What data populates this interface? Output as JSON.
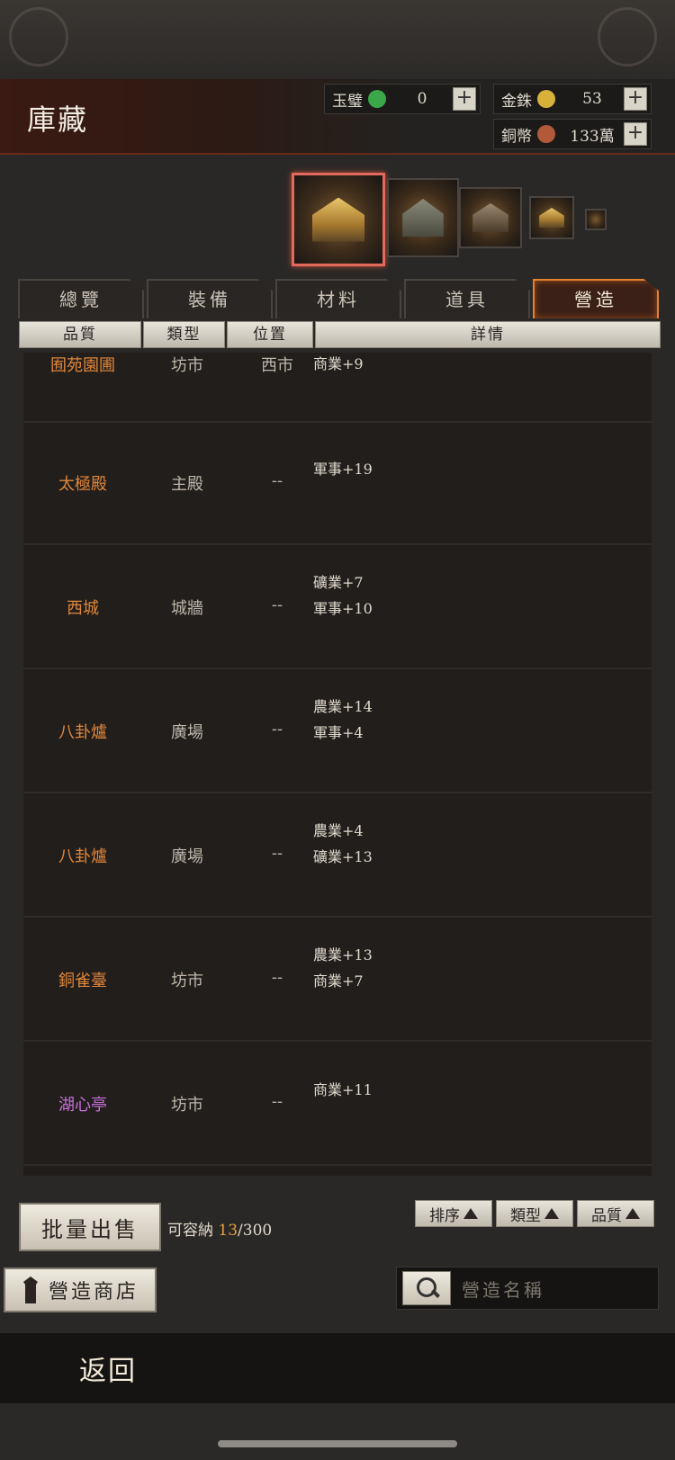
{
  "header": {
    "title": "庫藏",
    "currencies": [
      {
        "label": "玉璧",
        "value": "0",
        "coin_color": "#3aa84a"
      },
      {
        "label": "金銖",
        "value": "53",
        "coin_color": "#d8b13a"
      },
      {
        "label": "銅幣",
        "value": "133萬",
        "coin_color": "#b05a3a"
      }
    ]
  },
  "tabs": [
    "總覽",
    "裝備",
    "材料",
    "道具",
    "營造"
  ],
  "active_tab": "營造",
  "columns": {
    "quality": "品質",
    "type": "類型",
    "location": "位置",
    "detail": "詳情"
  },
  "rows": [
    {
      "name": "囿苑園圃",
      "type": "坊市",
      "location": "西市",
      "details": [
        "商業+9"
      ],
      "quality_color": "#e0873a"
    },
    {
      "name": "太極殿",
      "type": "主殿",
      "location": "--",
      "details": [
        "軍事+19"
      ],
      "quality_color": "#e0873a"
    },
    {
      "name": "西城",
      "type": "城牆",
      "location": "--",
      "details": [
        "礦業+7",
        "軍事+10"
      ],
      "quality_color": "#e0873a"
    },
    {
      "name": "八卦爐",
      "type": "廣場",
      "location": "--",
      "details": [
        "農業+14",
        "軍事+4"
      ],
      "quality_color": "#e0873a"
    },
    {
      "name": "八卦爐",
      "type": "廣場",
      "location": "--",
      "details": [
        "農業+4",
        "礦業+13"
      ],
      "quality_color": "#e0873a"
    },
    {
      "name": "銅雀臺",
      "type": "坊市",
      "location": "--",
      "details": [
        "農業+13",
        "商業+7"
      ],
      "quality_color": "#e0873a"
    },
    {
      "name": "湖心亭",
      "type": "坊市",
      "location": "--",
      "details": [
        "商業+11"
      ],
      "quality_color": "#c770d9"
    }
  ],
  "actions": {
    "batch_sell": "批量出售",
    "capacity_label": "可容納",
    "capacity_current": "13",
    "capacity_max": "/300",
    "sort_buttons": [
      "排序",
      "類型",
      "品質"
    ],
    "shop_button": "營造商店",
    "search_placeholder": "營造名稱",
    "back": "返回"
  }
}
